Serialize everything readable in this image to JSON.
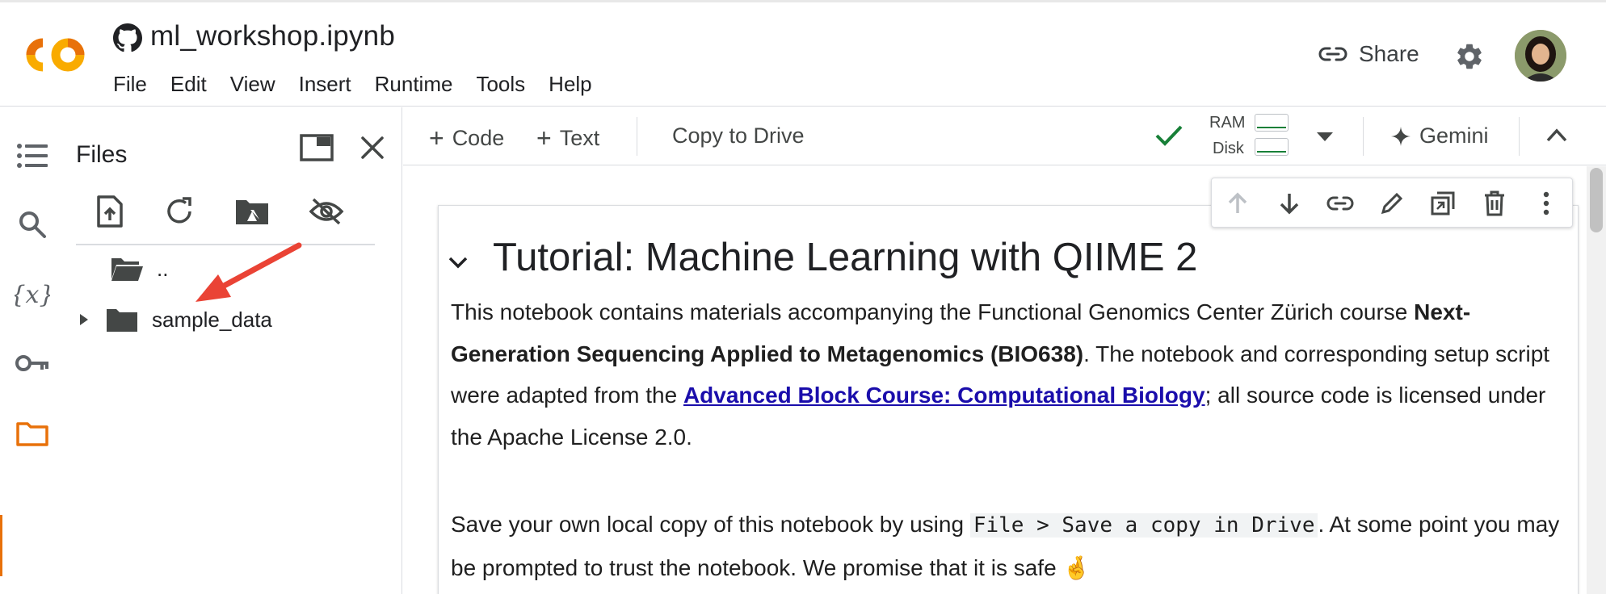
{
  "header": {
    "notebook_title": "ml_workshop.ipynb",
    "menu": [
      "File",
      "Edit",
      "View",
      "Insert",
      "Runtime",
      "Tools",
      "Help"
    ],
    "share_label": "Share"
  },
  "files_panel": {
    "title": "Files",
    "items": [
      {
        "name": "..",
        "type": "parent-folder"
      },
      {
        "name": "sample_data",
        "type": "folder"
      }
    ]
  },
  "toolbar": {
    "add_code": "Code",
    "add_text": "Text",
    "copy_to_drive": "Copy to Drive",
    "ram_label": "RAM",
    "disk_label": "Disk",
    "gemini_label": "Gemini"
  },
  "cell": {
    "heading": "Tutorial: Machine Learning with QIIME 2",
    "p1_text1": "This notebook contains materials accompanying the Functional Genomics Center Zürich course ",
    "p1_bold": "Next-Generation Sequencing Applied to Metagenomics (BIO638)",
    "p1_text2": ". The notebook and corresponding setup script were adapted from the ",
    "p1_link": "Advanced Block Course: Computational Biology",
    "p1_text3": "; all source code is licensed under the Apache License 2.0.",
    "p2_text1": "Save your own local copy of this notebook by using ",
    "p2_code": "File > Save a copy in Drive",
    "p2_text2": ". At some point you may be prompted to trust the notebook. We promise that it is safe 🤞"
  },
  "colors": {
    "accent_orange": "#e8710a",
    "logo_yellow": "#f9ab00",
    "link_blue": "#1a0dab",
    "connected_green": "#188038",
    "arrow_red": "#ea4335"
  }
}
